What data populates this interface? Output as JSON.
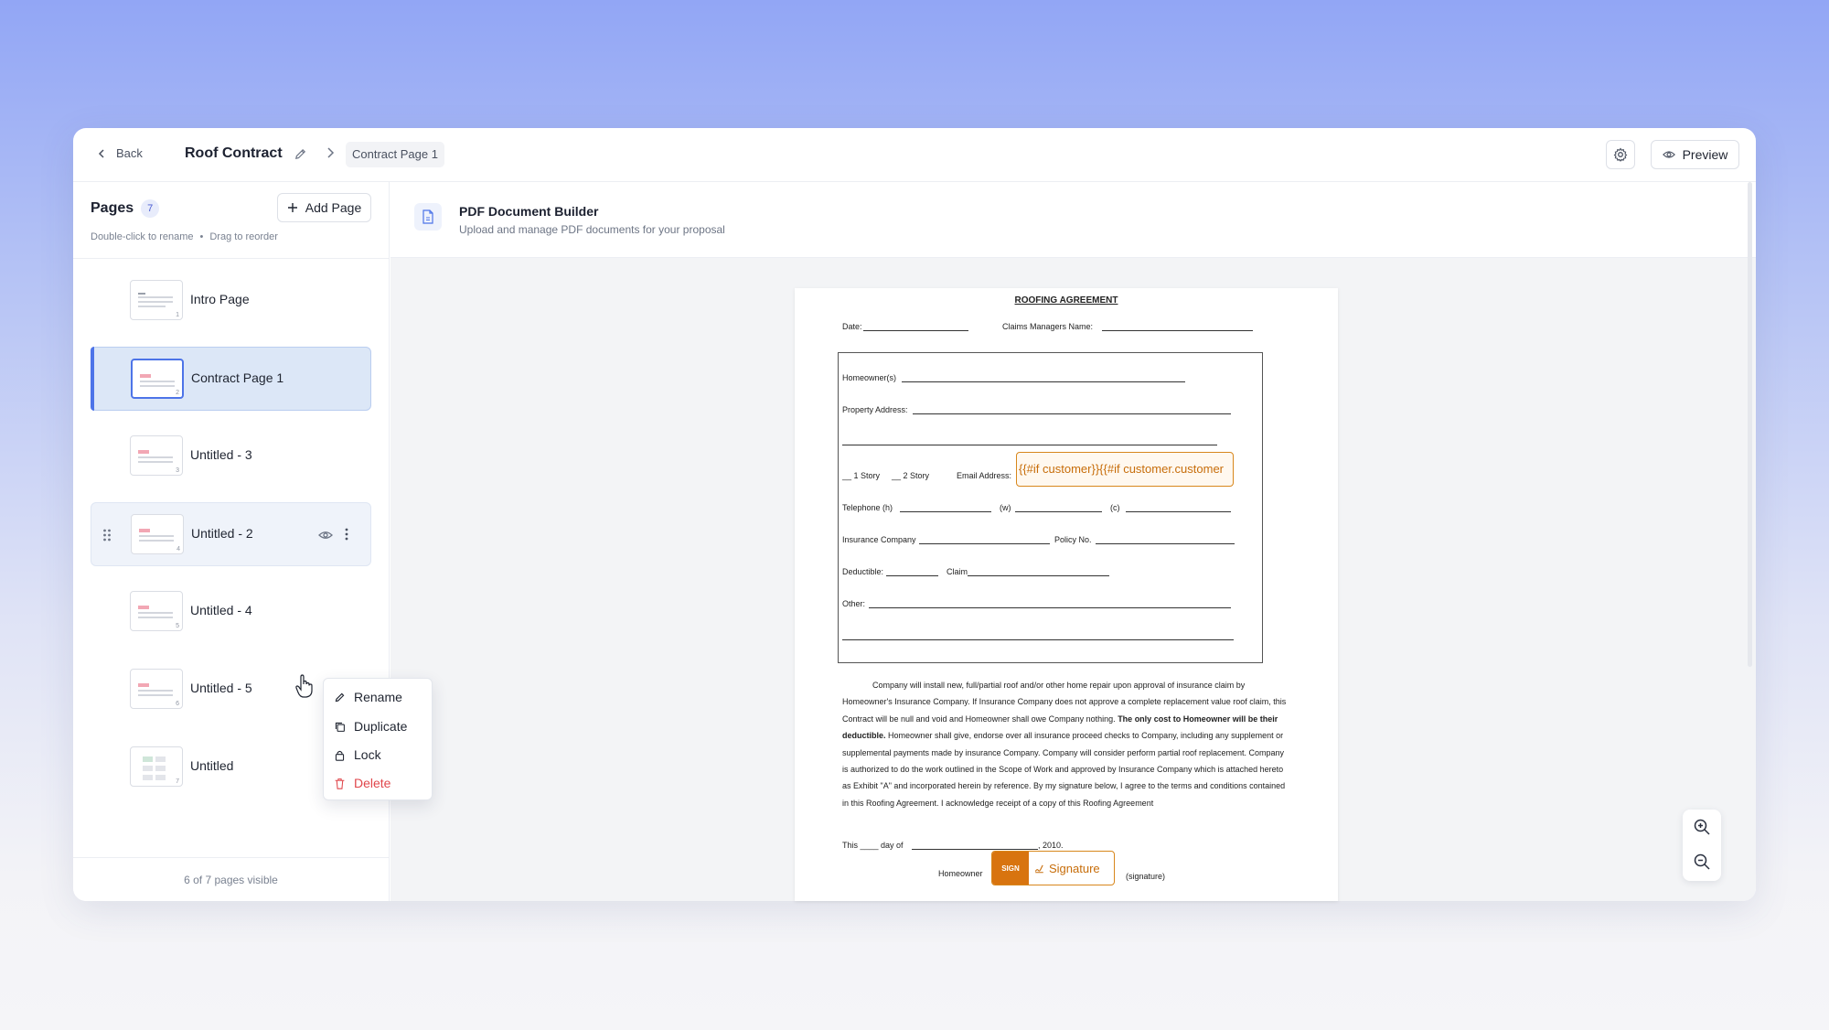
{
  "header": {
    "back_label": "Back",
    "doc_title": "Roof Contract",
    "breadcrumb_current": "Contract Page 1",
    "preview_label": "Preview"
  },
  "sidebar": {
    "title": "Pages",
    "count": "7",
    "add_page_label": "Add Page",
    "hint_rename": "Double-click to rename",
    "hint_bullet": "•",
    "hint_reorder": "Drag to reorder",
    "footer": "6 of 7 pages visible",
    "pages": [
      {
        "label": "Intro Page",
        "num": "1"
      },
      {
        "label": "Contract Page 1",
        "num": "2"
      },
      {
        "label": "Untitled - 3",
        "num": "3"
      },
      {
        "label": "Untitled - 2",
        "num": "4"
      },
      {
        "label": "Untitled - 4",
        "num": "5"
      },
      {
        "label": "Untitled - 5",
        "num": "6"
      },
      {
        "label": "Untitled",
        "num": "7"
      }
    ]
  },
  "context_menu": {
    "rename": "Rename",
    "duplicate": "Duplicate",
    "lock": "Lock",
    "delete": "Delete"
  },
  "main": {
    "title": "PDF Document Builder",
    "subtitle": "Upload and manage PDF documents for your proposal"
  },
  "document": {
    "title": "ROOFING AGREEMENT",
    "date_label": "Date:",
    "claims_label": "Claims Managers Name:",
    "homeowner_label": "Homeowner(s)",
    "property_label": "Property Address:",
    "story1": "__ 1 Story",
    "story2": "__ 2 Story",
    "email_label": "Email Address:",
    "email_tag": "{{#if customer}}{{#if customer.customer",
    "telephone_label": "Telephone (h)",
    "w_label": "(w)",
    "c_label": "(c)",
    "insurance_label": "Insurance Company",
    "policy_label": "Policy No.",
    "deductible_label": "Deductible:",
    "claim_label": "Claim",
    "other_label": "Other:",
    "para1": "Company will install new, full/partial roof and/or other home repair upon approval of insurance claim by Homeowner's Insurance Company.  If Insurance Company does not approve a complete replacement value roof claim, this Contract will be null and void and Homeowner shall owe Company nothing.",
    "para_bold": "The only cost to Homeowner will be their deductible.",
    "para2": "Homeowner shall give, endorse over all insurance proceed checks to Company, including any supplement or supplemental payments made by insurance Company.  Company will consider perform partial roof replacement.  Company is authorized to do the work outlined in the Scope of Work and approved by Insurance Company which is attached hereto as Exhibit \"A\" and incorporated herein by reference.  By my signature below, I agree to the terms and conditions contained in this Roofing Agreement.  I acknowledge receipt of a copy of this Roofing Agreement",
    "this_label": "This ____ day of",
    "year_label": ", 2010.",
    "homeowner_sig_label": "Homeowner",
    "sign_tag": "SIGN",
    "signature_label": "Signature",
    "signature_suffix": "(signature)"
  },
  "colors": {
    "accent": "#4d74e8",
    "active_bg": "#dce7f7",
    "field_orange": "#d8871c",
    "danger": "#e0464b"
  }
}
